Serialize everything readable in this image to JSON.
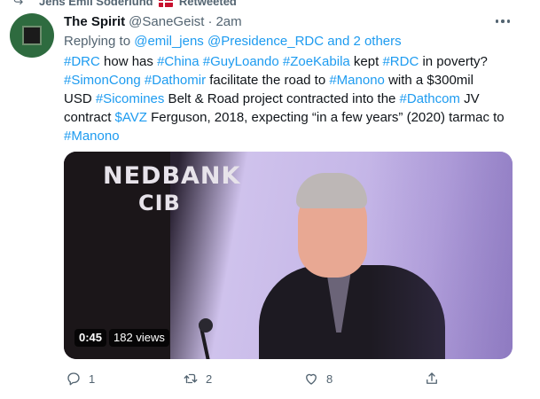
{
  "retweet": {
    "text_before_flag": "Jens Emil Söderlund",
    "text_after_flag": "Retweeted",
    "icon": "retweet-icon",
    "flag_icon": "denmark-flag-icon"
  },
  "tweet": {
    "author_name": "The Spirit",
    "author_handle": "@SaneGeist",
    "separator": "·",
    "time": "2am",
    "avatar_icon": "circuit-chip-avatar",
    "more_icon": "more-horizontal-icon",
    "reply_prefix": "Replying to",
    "reply_targets": "@emil_jens @Presidence_RDC and 2 others",
    "text_lines": [
      [
        {
          "t": "#DRC",
          "tag": true
        },
        {
          "t": " how has ",
          "tag": false
        },
        {
          "t": "#China",
          "tag": true
        },
        {
          "t": " ",
          "tag": false
        },
        {
          "t": "#GuyLoando",
          "tag": true
        },
        {
          "t": " ",
          "tag": false
        },
        {
          "t": "#ZoeKabila",
          "tag": true
        },
        {
          "t": " kept ",
          "tag": false
        },
        {
          "t": "#RDC",
          "tag": true
        },
        {
          "t": " in poverty?",
          "tag": false
        }
      ],
      [
        {
          "t": "#SimonCong",
          "tag": true
        },
        {
          "t": " ",
          "tag": false
        },
        {
          "t": "#Dathomir",
          "tag": true
        },
        {
          "t": " facilitate the road to ",
          "tag": false
        },
        {
          "t": "#Manono",
          "tag": true
        },
        {
          "t": " with a $300mil",
          "tag": false
        }
      ],
      [
        {
          "t": "USD ",
          "tag": false
        },
        {
          "t": "#Sicomines",
          "tag": true
        },
        {
          "t": " Belt & Road project contracted into the ",
          "tag": false
        },
        {
          "t": "#Dathcom",
          "tag": true
        },
        {
          "t": " JV",
          "tag": false
        }
      ],
      [
        {
          "t": "contract ",
          "tag": false
        },
        {
          "t": "$AVZ",
          "tag": true
        },
        {
          "t": " Ferguson, 2018, expecting “in a few years” (2020) tarmac to",
          "tag": false
        }
      ],
      [
        {
          "t": "#Manono",
          "tag": true
        }
      ]
    ]
  },
  "media": {
    "overlay_text_1": "NEDBANK",
    "overlay_text_2": "CIB",
    "duration": "0:45",
    "views": "182 views"
  },
  "actions": {
    "reply_count": "1",
    "retweet_count": "2",
    "like_count": "8",
    "share_label": ""
  },
  "colors": {
    "link": "#1d9bf0",
    "muted": "#536471",
    "text": "#0f1419"
  }
}
